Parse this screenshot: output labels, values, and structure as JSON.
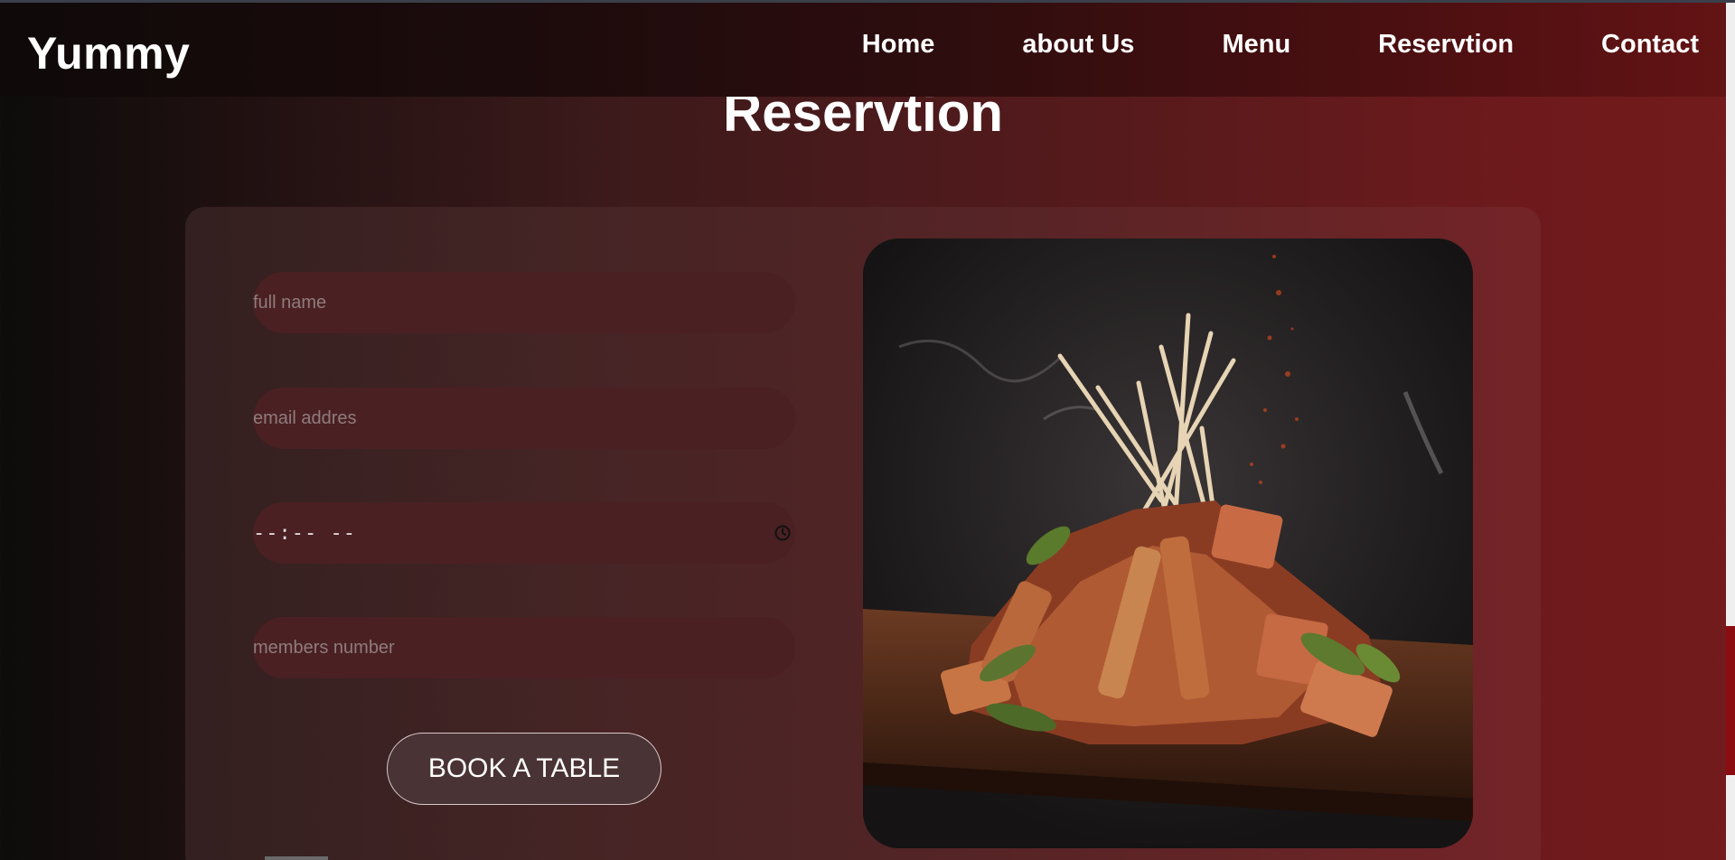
{
  "brand": "Yummy",
  "nav": {
    "items": [
      {
        "label": "Home"
      },
      {
        "label": "about Us"
      },
      {
        "label": "Menu"
      },
      {
        "label": "Reservtion"
      },
      {
        "label": "Contact"
      }
    ]
  },
  "section": {
    "title": "Reservtion"
  },
  "form": {
    "name_placeholder": "full name",
    "email_placeholder": "email addres",
    "time_value": "--:-- --",
    "members_placeholder": "members number",
    "submit_label": "BOOK A TABLE"
  },
  "image": {
    "subject": "food-skewers-photo"
  },
  "colors": {
    "accent": "#8b0d12",
    "field_bg": "#4a2023",
    "button_bg": "#4a3334"
  }
}
